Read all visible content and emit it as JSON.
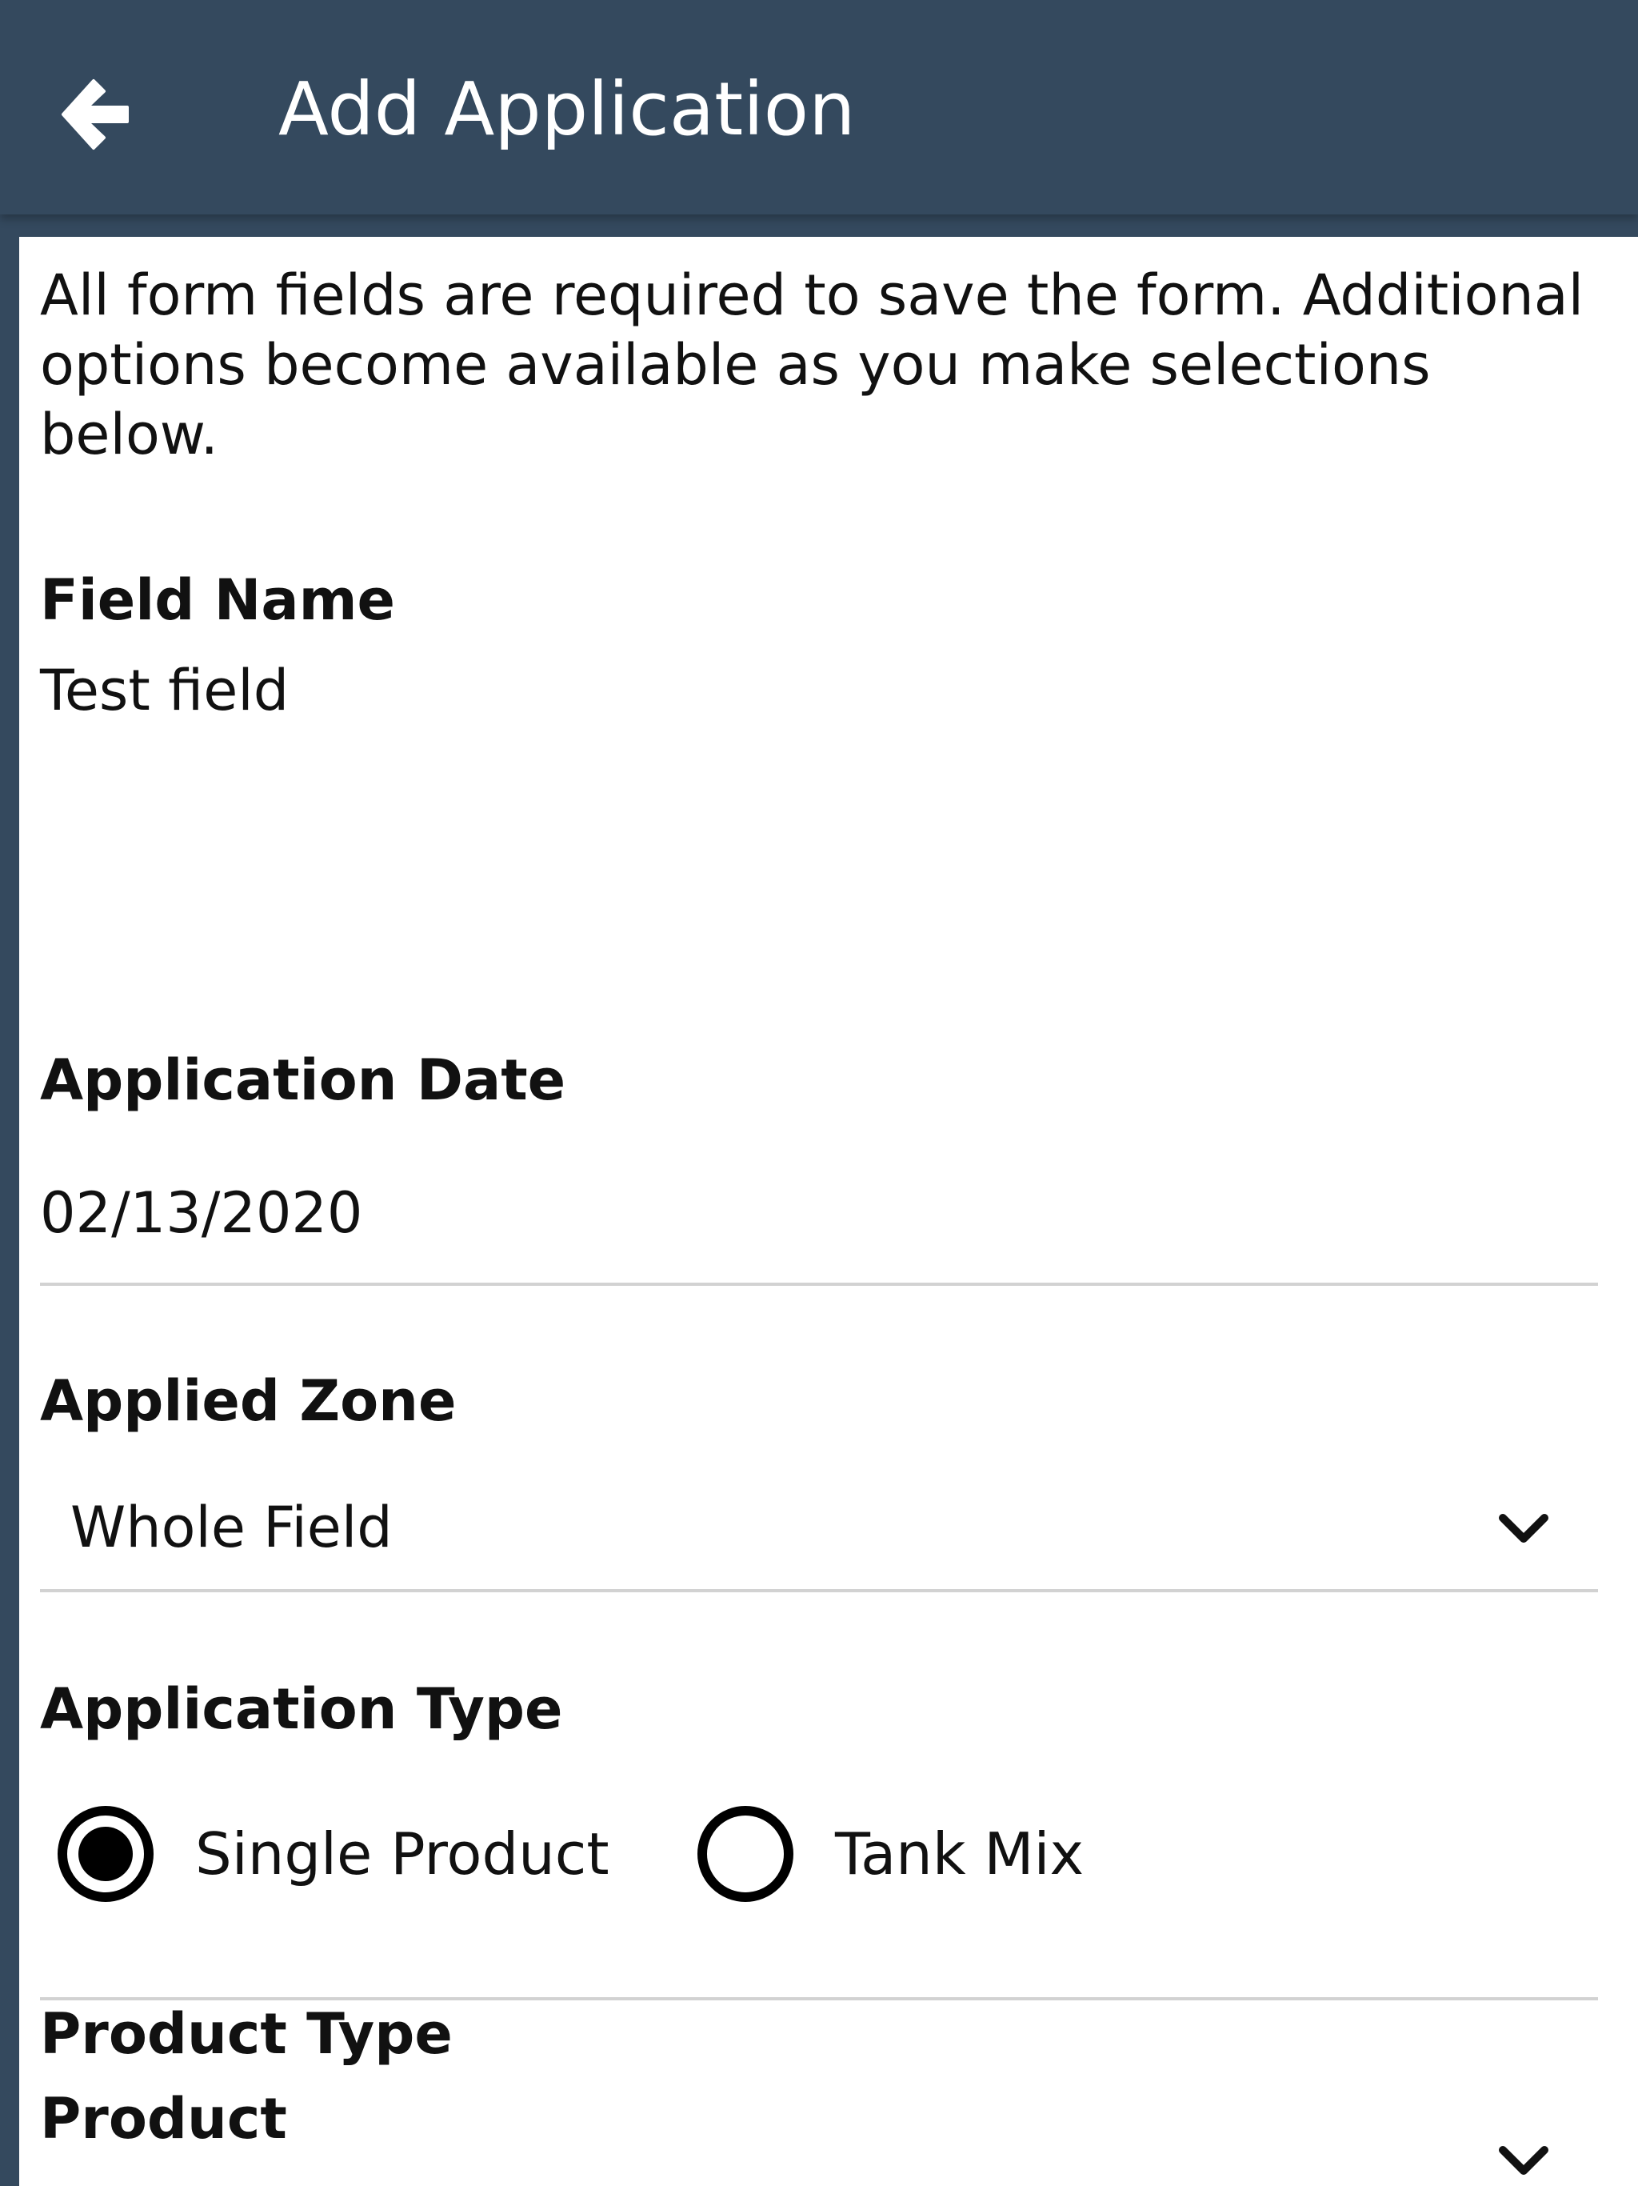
{
  "header": {
    "title": "Add Application",
    "back_icon": "arrow-left-icon"
  },
  "form": {
    "intro": "All form fields are required to save the form. Additional options become available as you make selections below.",
    "field_name": {
      "label": "Field Name",
      "value": "Test field"
    },
    "application_date": {
      "label": "Application Date",
      "value": "02/13/2020"
    },
    "applied_zone": {
      "label": "Applied Zone",
      "selected": "Whole Field"
    },
    "application_type": {
      "label": "Application Type",
      "options": [
        {
          "label": "Single Product",
          "selected": true
        },
        {
          "label": "Tank Mix",
          "selected": false
        }
      ]
    },
    "product_type": {
      "label": "Product Type",
      "selected": ""
    },
    "product": {
      "label": "Product"
    }
  },
  "colors": {
    "header_bg": "#34495e",
    "divider": "#d2d2d2"
  }
}
